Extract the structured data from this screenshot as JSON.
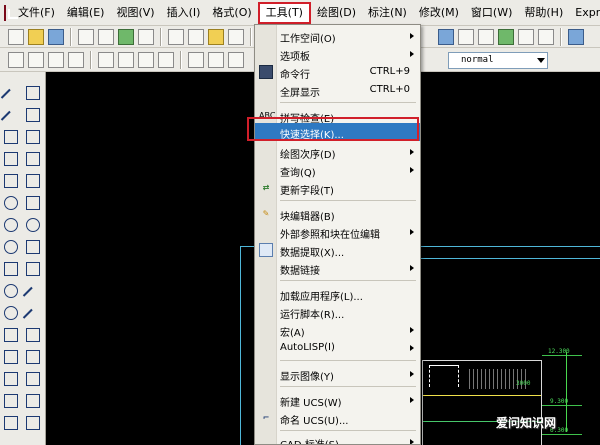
{
  "menubar": {
    "items": [
      {
        "label": "文件(F)"
      },
      {
        "label": "编辑(E)"
      },
      {
        "label": "视图(V)"
      },
      {
        "label": "插入(I)"
      },
      {
        "label": "格式(O)"
      },
      {
        "label": "工具(T)"
      },
      {
        "label": "绘图(D)"
      },
      {
        "label": "标注(N)"
      },
      {
        "label": "修改(M)"
      },
      {
        "label": "窗口(W)"
      },
      {
        "label": "帮助(H)"
      },
      {
        "label": "Express"
      }
    ]
  },
  "toolbar": {
    "style_combo_value": "normal"
  },
  "tools_menu": {
    "items": [
      {
        "label": "工作空间(O)"
      },
      {
        "label": "选项板"
      },
      {
        "label": "命令行",
        "shortcut": "CTRL+9"
      },
      {
        "label": "全屏显示",
        "shortcut": "CTRL+0"
      },
      {
        "label": "拼写检查(E)",
        "icon": "ABC"
      },
      {
        "label": "快速选择(K)..."
      },
      {
        "label": "绘图次序(D)"
      },
      {
        "label": "查询(Q)"
      },
      {
        "label": "更新字段(T)"
      },
      {
        "label": "块编辑器(B)"
      },
      {
        "label": "外部参照和块在位编辑"
      },
      {
        "label": "数据提取(X)..."
      },
      {
        "label": "数据链接"
      },
      {
        "label": "加载应用程序(L)..."
      },
      {
        "label": "运行脚本(R)..."
      },
      {
        "label": "宏(A)"
      },
      {
        "label": "AutoLISP(I)"
      },
      {
        "label": "显示图像(Y)"
      },
      {
        "label": "新建 UCS(W)"
      },
      {
        "label": "命名 UCS(U)..."
      },
      {
        "label": "CAD 标准(S)"
      }
    ]
  },
  "drawing": {
    "dimensions": [
      "12.300",
      "9.300",
      "6.300",
      "3000"
    ]
  },
  "watermark": "爱问知识网"
}
